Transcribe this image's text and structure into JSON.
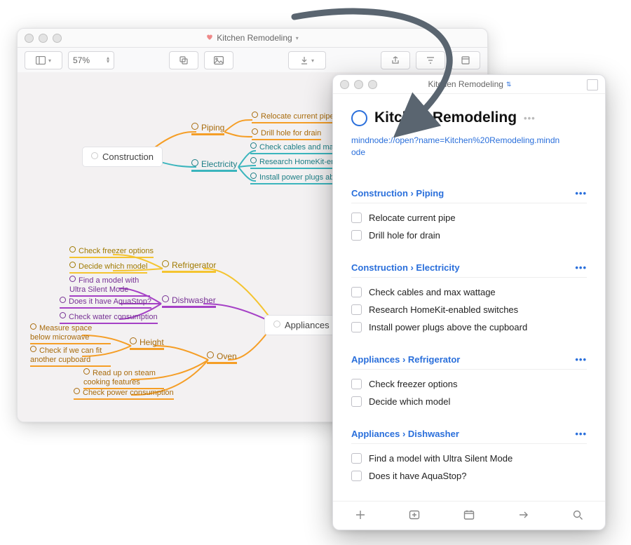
{
  "mindnode": {
    "title": "Kitchen Remodeling",
    "zoom": "57%",
    "root_nodes": {
      "construction": "Construction",
      "appliances": "Appliances"
    },
    "categories": {
      "piping": "Piping",
      "electricity": "Electricity",
      "refrigerator": "Refrigerator",
      "dishwasher": "Dishwasher",
      "oven": "Oven",
      "height": "Height"
    },
    "leaves": {
      "relocate_pipe": "Relocate current pipe",
      "drill_drain": "Drill hole for drain",
      "check_cables": "Check cables and max wattage",
      "research_homekit": "Research HomeKit-enabled swit",
      "install_plugs": "Install power plugs above the cu",
      "check_freezer": "Check freezer options",
      "decide_model": "Decide which model",
      "find_ultrasilent": "Find a model with Ultra Silent Mode",
      "has_aquastop": "Does it have AquaStop?",
      "water_cons": "Check water consumption",
      "measure_space": "Measure space below microwave",
      "check_cupboard": "Check if we can fit another cupboard",
      "steam_cooking": "Read up on steam cooking features",
      "power_cons": "Check power consumption"
    }
  },
  "things": {
    "window_title": "Kitchen Remodeling",
    "project_title": "Kitchen Remodeling",
    "link": "mindnode://open?name=Kitchen%20Remodeling.mindnode",
    "groups": [
      {
        "name": "Construction › Piping",
        "tasks": [
          "Relocate current pipe",
          "Drill hole for drain"
        ]
      },
      {
        "name": "Construction › Electricity",
        "tasks": [
          "Check cables and max wattage",
          "Research HomeKit-enabled switches",
          "Install power plugs above the cupboard"
        ]
      },
      {
        "name": "Appliances › Refrigerator",
        "tasks": [
          "Check freezer options",
          "Decide which model"
        ]
      },
      {
        "name": "Appliances › Dishwasher",
        "tasks": [
          "Find a model with Ultra Silent Mode",
          "Does it have AquaStop?"
        ]
      }
    ]
  }
}
